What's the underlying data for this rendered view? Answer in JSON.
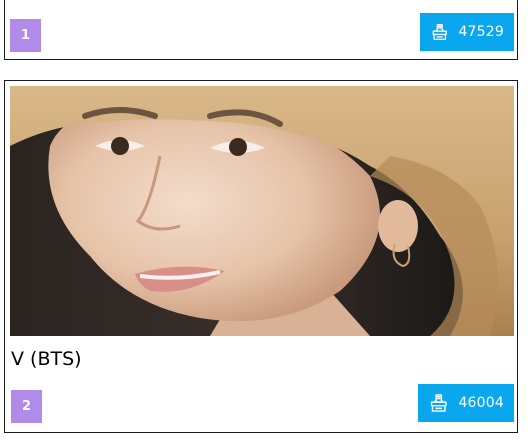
{
  "entries": [
    {
      "rank": "1",
      "votes": "47529",
      "name": ""
    },
    {
      "rank": "2",
      "votes": "46004",
      "name": "V (BTS)"
    }
  ],
  "icons": {
    "vote": "ballot-box-icon"
  },
  "colors": {
    "rank_badge": "#b18bea",
    "vote_button": "#0aa7ef"
  }
}
